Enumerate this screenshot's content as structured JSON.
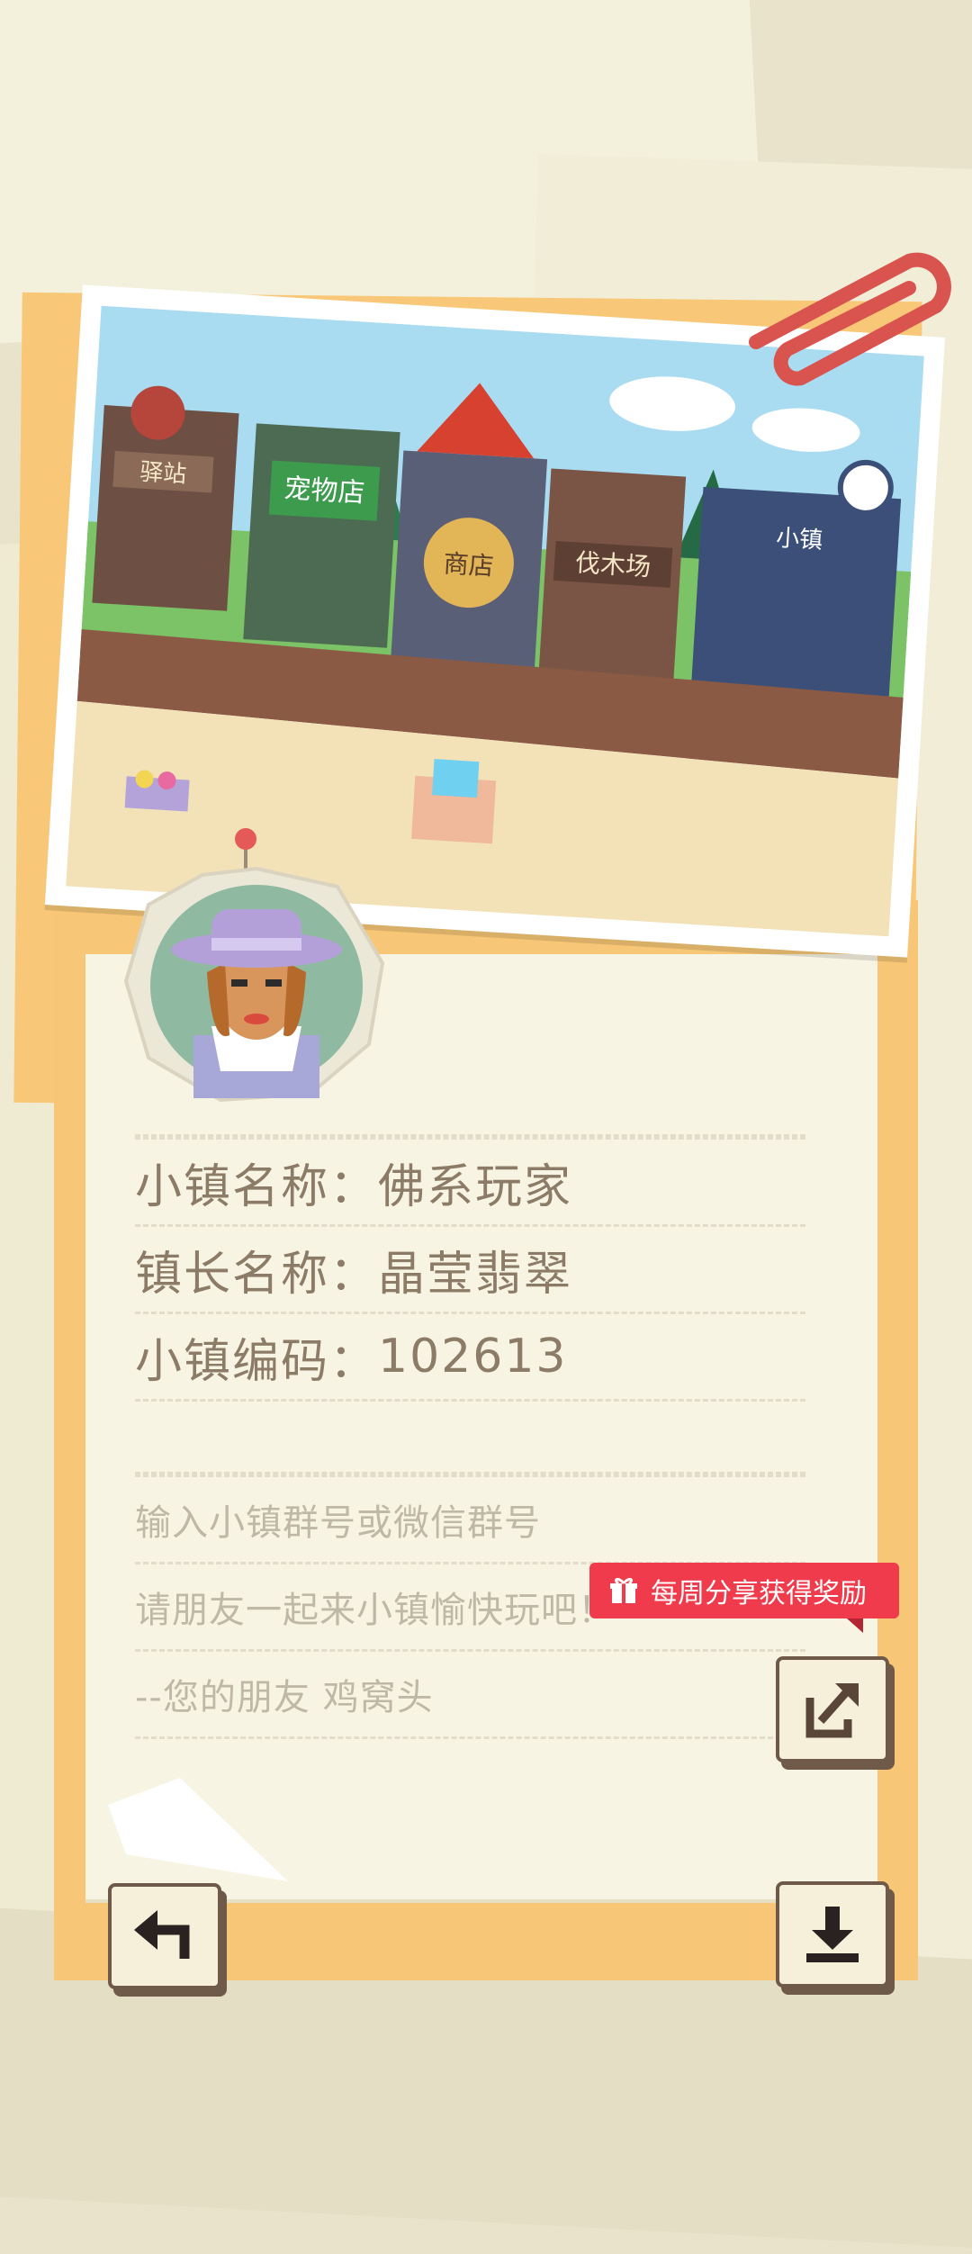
{
  "town_card": {
    "fields": [
      {
        "label": "小镇名称：",
        "value": "佛系玩家"
      },
      {
        "label": "镇长名称：",
        "value": "晶莹翡翠"
      },
      {
        "label": "小镇编码：",
        "value": "102613"
      }
    ]
  },
  "invite_message": {
    "line1": "输入小镇群号或微信群号",
    "line2": "请朋友一起来小镇愉快玩吧！",
    "line3": "--您的朋友 鸡窝头"
  },
  "reward_badge": {
    "label": "每周分享获得奖励",
    "icon": "gift-icon"
  },
  "photo": {
    "signs": {
      "station": "驿站",
      "pet_shop": "宠物店",
      "shop": "商店",
      "lumber": "伐木场",
      "town_hall": "小镇"
    }
  },
  "buttons": {
    "share_icon": "share-icon",
    "back_icon": "back-arrow-icon",
    "download_icon": "download-icon"
  },
  "colors": {
    "folder": "#f7c676",
    "note": "#f7f4e3",
    "badge": "#ef3b4b",
    "text": "#8c7b66",
    "button_border": "#6f5a49"
  }
}
